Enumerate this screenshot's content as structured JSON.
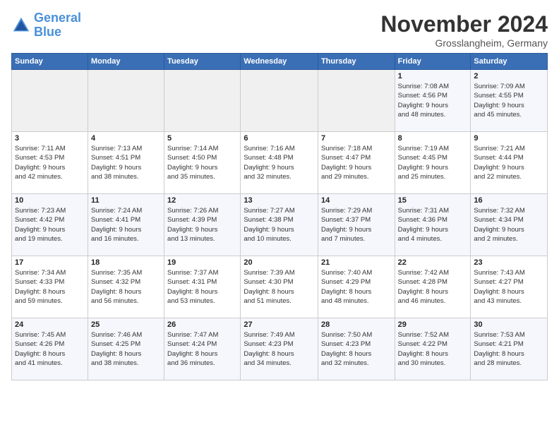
{
  "logo": {
    "line1": "General",
    "line2": "Blue"
  },
  "title": "November 2024",
  "location": "Grosslangheim, Germany",
  "days_header": [
    "Sunday",
    "Monday",
    "Tuesday",
    "Wednesday",
    "Thursday",
    "Friday",
    "Saturday"
  ],
  "weeks": [
    [
      {
        "day": "",
        "info": ""
      },
      {
        "day": "",
        "info": ""
      },
      {
        "day": "",
        "info": ""
      },
      {
        "day": "",
        "info": ""
      },
      {
        "day": "",
        "info": ""
      },
      {
        "day": "1",
        "info": "Sunrise: 7:08 AM\nSunset: 4:56 PM\nDaylight: 9 hours\nand 48 minutes."
      },
      {
        "day": "2",
        "info": "Sunrise: 7:09 AM\nSunset: 4:55 PM\nDaylight: 9 hours\nand 45 minutes."
      }
    ],
    [
      {
        "day": "3",
        "info": "Sunrise: 7:11 AM\nSunset: 4:53 PM\nDaylight: 9 hours\nand 42 minutes."
      },
      {
        "day": "4",
        "info": "Sunrise: 7:13 AM\nSunset: 4:51 PM\nDaylight: 9 hours\nand 38 minutes."
      },
      {
        "day": "5",
        "info": "Sunrise: 7:14 AM\nSunset: 4:50 PM\nDaylight: 9 hours\nand 35 minutes."
      },
      {
        "day": "6",
        "info": "Sunrise: 7:16 AM\nSunset: 4:48 PM\nDaylight: 9 hours\nand 32 minutes."
      },
      {
        "day": "7",
        "info": "Sunrise: 7:18 AM\nSunset: 4:47 PM\nDaylight: 9 hours\nand 29 minutes."
      },
      {
        "day": "8",
        "info": "Sunrise: 7:19 AM\nSunset: 4:45 PM\nDaylight: 9 hours\nand 25 minutes."
      },
      {
        "day": "9",
        "info": "Sunrise: 7:21 AM\nSunset: 4:44 PM\nDaylight: 9 hours\nand 22 minutes."
      }
    ],
    [
      {
        "day": "10",
        "info": "Sunrise: 7:23 AM\nSunset: 4:42 PM\nDaylight: 9 hours\nand 19 minutes."
      },
      {
        "day": "11",
        "info": "Sunrise: 7:24 AM\nSunset: 4:41 PM\nDaylight: 9 hours\nand 16 minutes."
      },
      {
        "day": "12",
        "info": "Sunrise: 7:26 AM\nSunset: 4:39 PM\nDaylight: 9 hours\nand 13 minutes."
      },
      {
        "day": "13",
        "info": "Sunrise: 7:27 AM\nSunset: 4:38 PM\nDaylight: 9 hours\nand 10 minutes."
      },
      {
        "day": "14",
        "info": "Sunrise: 7:29 AM\nSunset: 4:37 PM\nDaylight: 9 hours\nand 7 minutes."
      },
      {
        "day": "15",
        "info": "Sunrise: 7:31 AM\nSunset: 4:36 PM\nDaylight: 9 hours\nand 4 minutes."
      },
      {
        "day": "16",
        "info": "Sunrise: 7:32 AM\nSunset: 4:34 PM\nDaylight: 9 hours\nand 2 minutes."
      }
    ],
    [
      {
        "day": "17",
        "info": "Sunrise: 7:34 AM\nSunset: 4:33 PM\nDaylight: 8 hours\nand 59 minutes."
      },
      {
        "day": "18",
        "info": "Sunrise: 7:35 AM\nSunset: 4:32 PM\nDaylight: 8 hours\nand 56 minutes."
      },
      {
        "day": "19",
        "info": "Sunrise: 7:37 AM\nSunset: 4:31 PM\nDaylight: 8 hours\nand 53 minutes."
      },
      {
        "day": "20",
        "info": "Sunrise: 7:39 AM\nSunset: 4:30 PM\nDaylight: 8 hours\nand 51 minutes."
      },
      {
        "day": "21",
        "info": "Sunrise: 7:40 AM\nSunset: 4:29 PM\nDaylight: 8 hours\nand 48 minutes."
      },
      {
        "day": "22",
        "info": "Sunrise: 7:42 AM\nSunset: 4:28 PM\nDaylight: 8 hours\nand 46 minutes."
      },
      {
        "day": "23",
        "info": "Sunrise: 7:43 AM\nSunset: 4:27 PM\nDaylight: 8 hours\nand 43 minutes."
      }
    ],
    [
      {
        "day": "24",
        "info": "Sunrise: 7:45 AM\nSunset: 4:26 PM\nDaylight: 8 hours\nand 41 minutes."
      },
      {
        "day": "25",
        "info": "Sunrise: 7:46 AM\nSunset: 4:25 PM\nDaylight: 8 hours\nand 38 minutes."
      },
      {
        "day": "26",
        "info": "Sunrise: 7:47 AM\nSunset: 4:24 PM\nDaylight: 8 hours\nand 36 minutes."
      },
      {
        "day": "27",
        "info": "Sunrise: 7:49 AM\nSunset: 4:23 PM\nDaylight: 8 hours\nand 34 minutes."
      },
      {
        "day": "28",
        "info": "Sunrise: 7:50 AM\nSunset: 4:23 PM\nDaylight: 8 hours\nand 32 minutes."
      },
      {
        "day": "29",
        "info": "Sunrise: 7:52 AM\nSunset: 4:22 PM\nDaylight: 8 hours\nand 30 minutes."
      },
      {
        "day": "30",
        "info": "Sunrise: 7:53 AM\nSunset: 4:21 PM\nDaylight: 8 hours\nand 28 minutes."
      }
    ]
  ]
}
